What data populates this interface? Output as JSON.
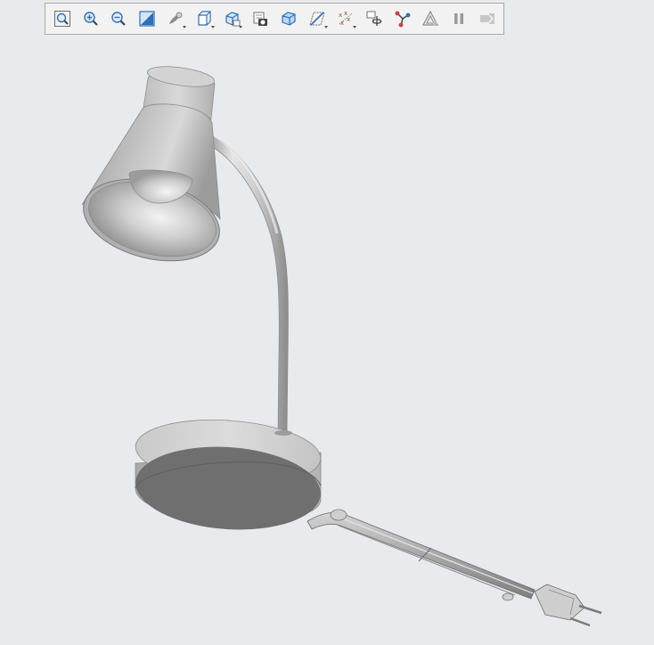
{
  "toolbar": {
    "buttons": [
      {
        "id": "refit",
        "icon": "refit-icon",
        "tooltip": ""
      },
      {
        "id": "zoom-in",
        "icon": "zoom-in-icon",
        "tooltip": ""
      },
      {
        "id": "zoom-out",
        "icon": "zoom-out-icon",
        "tooltip": ""
      },
      {
        "id": "repaint",
        "icon": "repaint-icon",
        "tooltip": ""
      },
      {
        "id": "display-style",
        "icon": "display-style-icon",
        "tooltip": ""
      },
      {
        "id": "saved-orientations",
        "icon": "saved-orientations-icon",
        "tooltip": ""
      },
      {
        "id": "view-manager",
        "icon": "view-manager-icon",
        "tooltip": ""
      },
      {
        "id": "perspective",
        "icon": "perspective-icon",
        "tooltip": ""
      },
      {
        "id": "section",
        "icon": "section-icon",
        "tooltip": ""
      },
      {
        "id": "datum-display",
        "icon": "datum-display-icon",
        "tooltip": ""
      },
      {
        "id": "annotation-display",
        "icon": "annotation-display-icon",
        "tooltip": ""
      },
      {
        "id": "spin-center",
        "icon": "spin-center-icon",
        "tooltip": ""
      },
      {
        "id": "model-tree-filter",
        "icon": "model-tree-filter-icon",
        "tooltip": ""
      },
      {
        "id": "regenerate",
        "icon": "regenerate-icon",
        "tooltip": ""
      },
      {
        "id": "pause",
        "icon": "pause-icon",
        "tooltip": ""
      },
      {
        "id": "next",
        "icon": "next-icon",
        "tooltip": ""
      }
    ]
  },
  "scene": {
    "model": "desk-lamp-model",
    "colors": {
      "background": "#e8eaee",
      "model_light": "#dedede",
      "model_mid": "#b4b4b4",
      "model_dark": "#6f6f6f",
      "toolbar_bg": "#f2f2f2",
      "toolbar_border": "#a9a9a9",
      "icon_blue": "#2f6fb6",
      "icon_gray": "#707070"
    }
  }
}
